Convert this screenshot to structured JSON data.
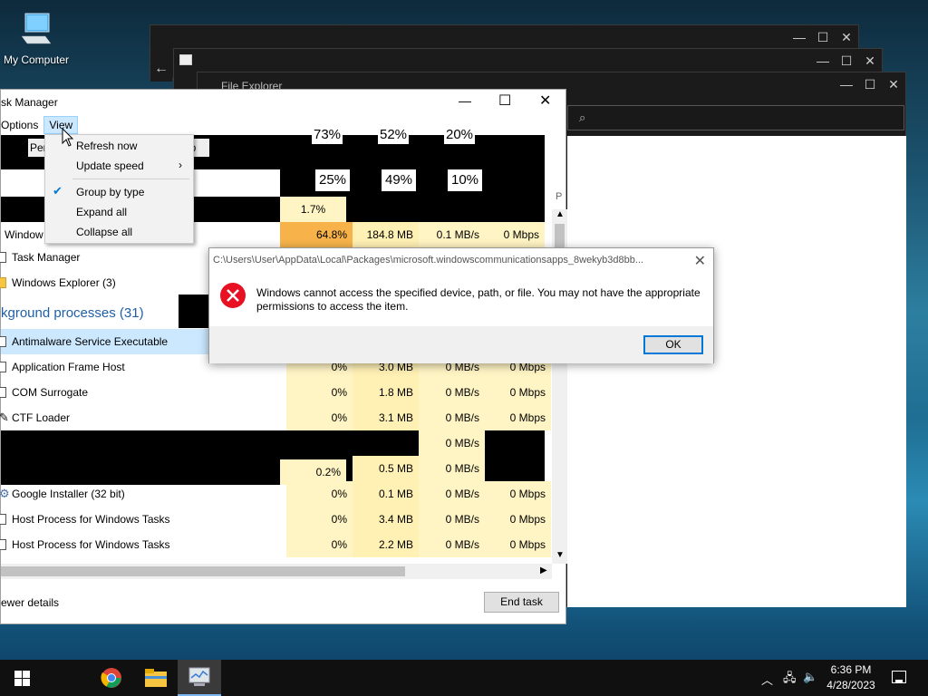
{
  "desktop": {
    "icon_label": "My Computer"
  },
  "file_explorer": {
    "title": "File Explorer"
  },
  "task_manager": {
    "title": "sk Manager",
    "menu": {
      "options": "Options",
      "view": "View"
    },
    "tab_fragments": {
      "left": "Per",
      "right": "up"
    },
    "header_percents": [
      "25%",
      "49%",
      "10%"
    ],
    "header_percents_top": [
      "73%",
      "52%",
      "20%"
    ],
    "cpu_header_value": "1.7%",
    "col_p": "P",
    "rows": {
      "windows": {
        "name": "Window",
        "cpu": "64.8%",
        "mem": "184.8 MB",
        "disk": "0.1 MB/s",
        "net": "0 Mbps"
      },
      "task_manager": {
        "name": "Task Manager"
      },
      "windows_explorer": {
        "name": "Windows Explorer (3)"
      },
      "bg_heading": "kground processes (31)",
      "antimalware": {
        "name": "Antimalware Service Executable"
      },
      "app_frame_host": {
        "name": "Application Frame Host",
        "cpu": "0%",
        "mem": "3.0 MB",
        "disk": "0 MB/s",
        "net": "0 Mbps"
      },
      "com_surrogate": {
        "name": "COM Surrogate",
        "cpu": "0%",
        "mem": "1.8 MB",
        "disk": "0 MB/s",
        "net": "0 Mbps"
      },
      "ctf_loader": {
        "name": "CTF Loader",
        "cpu": "0%",
        "mem": "3.1 MB",
        "disk": "0 MB/s",
        "net": "0 Mbps"
      },
      "hidden1": {
        "disk": "0 MB/s"
      },
      "hidden2": {
        "cpu": "0.2%",
        "mem": "0.5 MB",
        "disk": "0 MB/s"
      },
      "google_installer": {
        "name": "Google Installer (32 bit)",
        "cpu": "0%",
        "mem": "0.1 MB",
        "disk": "0 MB/s",
        "net": "0 Mbps"
      },
      "host1": {
        "name": "Host Process for Windows Tasks",
        "cpu": "0%",
        "mem": "3.4 MB",
        "disk": "0 MB/s",
        "net": "0 Mbps"
      },
      "host2": {
        "name": "Host Process for Windows Tasks",
        "cpu": "0%",
        "mem": "2.2 MB",
        "disk": "0 MB/s",
        "net": "0 Mbps"
      }
    },
    "fewer_details": "ewer details",
    "end_task": "End task"
  },
  "view_menu": {
    "items": [
      "Refresh now",
      "Update speed",
      "Group by type",
      "Expand all",
      "Collapse all"
    ]
  },
  "error_dialog": {
    "caption": "C:\\Users\\User\\AppData\\Local\\Packages\\microsoft.windowscommunicationsapps_8wekyb3d8bb...",
    "message": "Windows cannot access the specified device, path, or file. You may not have the appropriate permissions to access the item.",
    "ok": "OK"
  },
  "taskbar": {
    "time": "6:36 PM",
    "date": "4/28/2023"
  },
  "colors": {
    "accent": "#0078d7",
    "error": "#e81123",
    "cpu_hot": "#f7b34a"
  }
}
